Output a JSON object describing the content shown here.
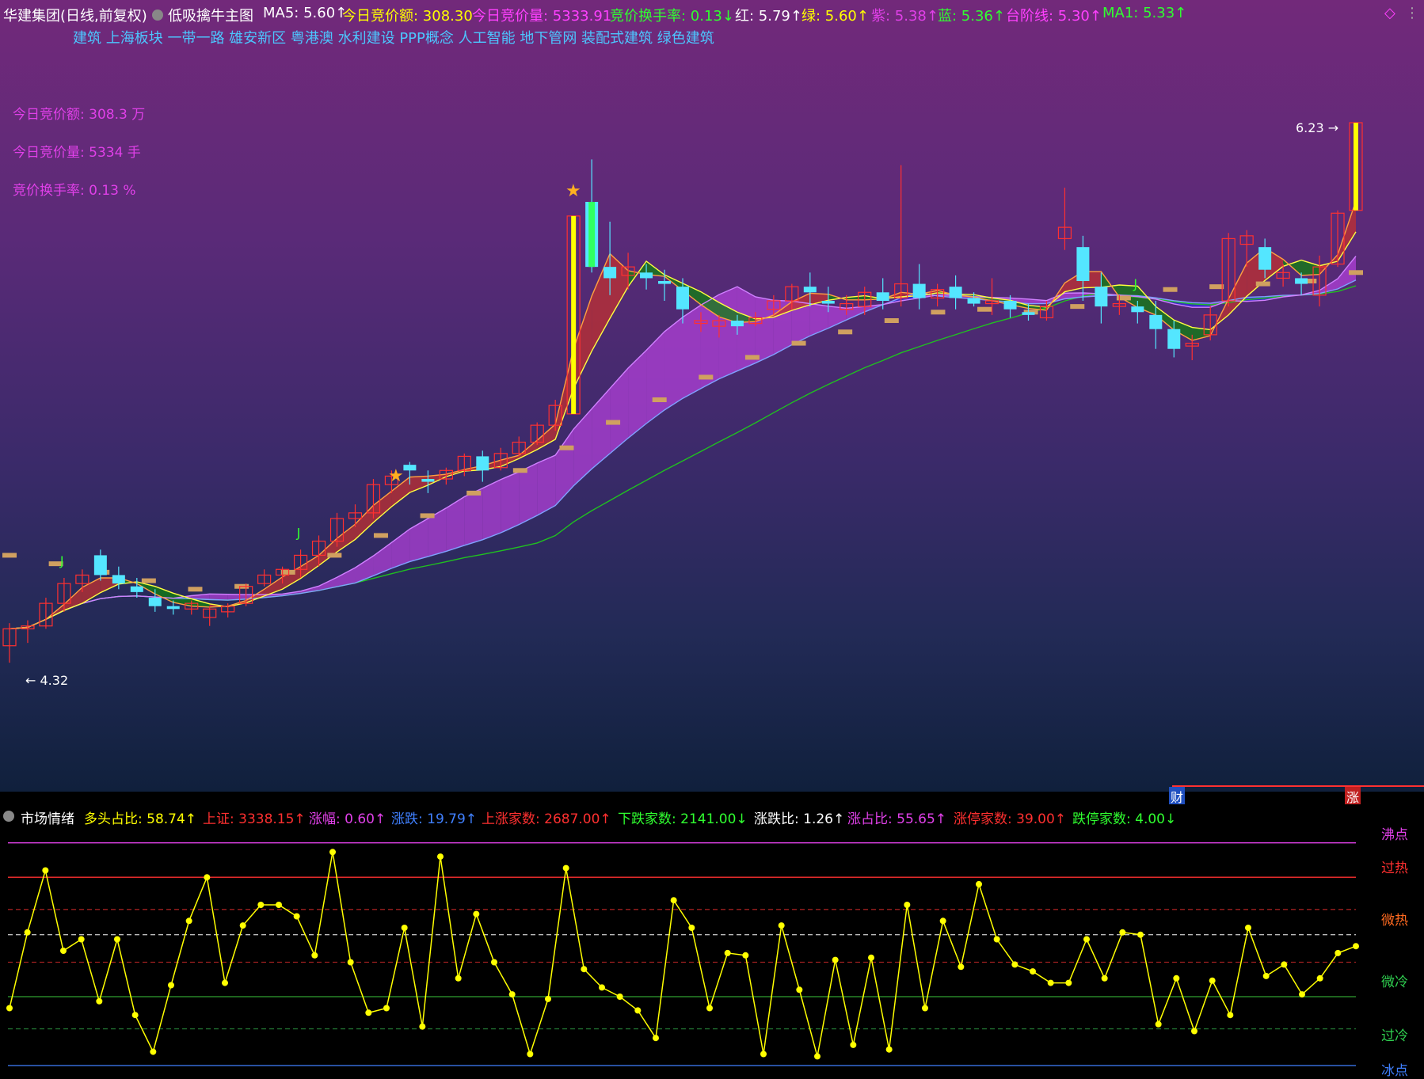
{
  "header": {
    "stock": "华建集团(日线,前复权)",
    "indicator": "低吸擒牛主图",
    "ma5": "MA5: 5.60↑",
    "bid_amount": "今日竞价额: 308.30",
    "bid_volume": "今日竞价量: 5333.91",
    "bid_turnover": "竞价换手率: 0.13↓",
    "red": "红: 5.79↑",
    "green": "绿: 5.60↑",
    "purple": "紫: 5.38↑",
    "blue": "蓝: 5.36↑",
    "step_line": "台阶线: 5.30↑",
    "ma1": "MA1: 5.33↑"
  },
  "concepts": "建筑 上海板块 一带一路 雄安新区 粤港澳 水利建设 PPP概念 人工智能 地下管网 装配式建筑 绿色建筑",
  "info_panel": {
    "amount": "今日竞价额: 308.3 万",
    "volume": "今日竞价量: 5334 手",
    "turnover": "竞价换手率: 0.13 %"
  },
  "price_labels": {
    "high": "6.23",
    "low": "4.32"
  },
  "markers": {
    "j": "J",
    "cai": "财",
    "zhang": "涨"
  },
  "sub_header": {
    "name": "市场情绪",
    "bull_ratio": "多头占比: 58.74↑",
    "shanghai": "上证: 3338.15↑",
    "change_pct": "涨幅: 0.60↑",
    "change": "涨跌: 19.79↑",
    "up_count": "上涨家数: 2687.00↑",
    "down_count": "下跌家数: 2141.00↓",
    "updown_ratio": "涨跌比: 1.26↑",
    "up_share": "涨占比: 55.65↑",
    "limit_up": "涨停家数: 39.00↑",
    "limit_down": "跌停家数: 4.00↓"
  },
  "zones": [
    "沸点",
    "过热",
    "微热",
    "微冷",
    "过冷",
    "冰点"
  ],
  "colors": {
    "up": "#ff3030",
    "down": "#54e6ff",
    "yellow": "#ffff00",
    "magenta": "#e040e8"
  },
  "chart_data": [
    {
      "type": "candlestick",
      "title": "低吸擒牛主图",
      "ylim": [
        4.2,
        6.3
      ],
      "candles": [
        [
          4.38,
          4.44,
          4.46,
          4.32
        ],
        [
          4.44,
          4.45,
          4.47,
          4.39
        ],
        [
          4.45,
          4.53,
          4.55,
          4.44
        ],
        [
          4.53,
          4.6,
          4.62,
          4.5
        ],
        [
          4.6,
          4.63,
          4.65,
          4.57
        ],
        [
          4.7,
          4.63,
          4.72,
          4.61
        ],
        [
          4.63,
          4.6,
          4.66,
          4.58
        ],
        [
          4.59,
          4.57,
          4.62,
          4.55
        ],
        [
          4.55,
          4.52,
          4.58,
          4.5
        ],
        [
          4.52,
          4.51,
          4.54,
          4.49
        ],
        [
          4.51,
          4.53,
          4.54,
          4.49
        ],
        [
          4.48,
          4.51,
          4.52,
          4.45
        ],
        [
          4.5,
          4.52,
          4.53,
          4.48
        ],
        [
          4.53,
          4.59,
          4.6,
          4.52
        ],
        [
          4.6,
          4.63,
          4.65,
          4.59
        ],
        [
          4.63,
          4.65,
          4.66,
          4.6
        ],
        [
          4.65,
          4.7,
          4.72,
          4.62
        ],
        [
          4.7,
          4.75,
          4.77,
          4.66
        ],
        [
          4.75,
          4.83,
          4.85,
          4.73
        ],
        [
          4.83,
          4.85,
          4.88,
          4.8
        ],
        [
          4.85,
          4.95,
          4.97,
          4.83
        ],
        [
          4.95,
          4.98,
          5.0,
          4.92
        ],
        [
          5.02,
          5.0,
          5.03,
          4.95
        ],
        [
          4.97,
          4.96,
          5.0,
          4.92
        ],
        [
          4.97,
          5.0,
          5.01,
          4.95
        ],
        [
          5.0,
          5.05,
          5.06,
          4.98
        ],
        [
          5.05,
          5.0,
          5.07,
          4.96
        ],
        [
          5.01,
          5.06,
          5.08,
          5.0
        ],
        [
          5.06,
          5.1,
          5.12,
          5.05
        ],
        [
          5.1,
          5.16,
          5.17,
          5.09
        ],
        [
          5.16,
          5.23,
          5.25,
          5.14
        ],
        [
          5.2,
          5.9,
          5.9,
          5.2
        ],
        [
          5.95,
          5.72,
          6.1,
          5.7
        ],
        [
          5.72,
          5.68,
          5.88,
          5.62
        ],
        [
          5.69,
          5.72,
          5.77,
          5.64
        ],
        [
          5.7,
          5.68,
          5.73,
          5.64
        ],
        [
          5.67,
          5.66,
          5.71,
          5.6
        ],
        [
          5.65,
          5.57,
          5.68,
          5.52
        ],
        [
          5.52,
          5.53,
          5.56,
          5.49
        ],
        [
          5.51,
          5.53,
          5.55,
          5.47
        ],
        [
          5.53,
          5.51,
          5.55,
          5.48
        ],
        [
          5.52,
          5.54,
          5.56,
          5.51
        ],
        [
          5.57,
          5.6,
          5.62,
          5.55
        ],
        [
          5.6,
          5.65,
          5.66,
          5.57
        ],
        [
          5.65,
          5.63,
          5.7,
          5.58
        ],
        [
          5.6,
          5.59,
          5.65,
          5.56
        ],
        [
          5.57,
          5.59,
          5.62,
          5.55
        ],
        [
          5.58,
          5.63,
          5.65,
          5.55
        ],
        [
          5.63,
          5.6,
          5.68,
          5.57
        ],
        [
          5.61,
          5.66,
          6.08,
          5.58
        ],
        [
          5.66,
          5.61,
          5.73,
          5.57
        ],
        [
          5.61,
          5.64,
          5.66,
          5.58
        ],
        [
          5.65,
          5.61,
          5.69,
          5.57
        ],
        [
          5.61,
          5.59,
          5.63,
          5.58
        ],
        [
          5.59,
          5.6,
          5.68,
          5.55
        ],
        [
          5.6,
          5.57,
          5.62,
          5.54
        ],
        [
          5.56,
          5.55,
          5.59,
          5.53
        ],
        [
          5.54,
          5.58,
          5.6,
          5.53
        ],
        [
          5.82,
          5.86,
          6.0,
          5.78
        ],
        [
          5.79,
          5.67,
          5.83,
          5.6
        ],
        [
          5.65,
          5.58,
          5.7,
          5.52
        ],
        [
          5.58,
          5.59,
          5.62,
          5.55
        ],
        [
          5.58,
          5.56,
          5.6,
          5.52
        ],
        [
          5.55,
          5.5,
          5.6,
          5.43
        ],
        [
          5.5,
          5.43,
          5.53,
          5.4
        ],
        [
          5.44,
          5.45,
          5.48,
          5.39
        ],
        [
          5.48,
          5.55,
          5.58,
          5.46
        ],
        [
          5.6,
          5.82,
          5.84,
          5.58
        ],
        [
          5.8,
          5.83,
          5.85,
          5.72
        ],
        [
          5.79,
          5.71,
          5.82,
          5.68
        ],
        [
          5.68,
          5.7,
          5.73,
          5.65
        ],
        [
          5.68,
          5.66,
          5.7,
          5.62
        ],
        [
          5.62,
          5.72,
          5.76,
          5.58
        ],
        [
          5.73,
          5.91,
          5.92,
          5.72
        ],
        [
          5.92,
          6.23,
          6.23,
          5.94
        ]
      ],
      "step_line": [
        4.7,
        4.67,
        4.64,
        4.61,
        4.58,
        4.59,
        4.64,
        4.7,
        4.77,
        4.84,
        4.92,
        5.0,
        5.08,
        5.17,
        5.25,
        5.33,
        5.4,
        5.45,
        5.49,
        5.53,
        5.56,
        5.57,
        5.56,
        5.58,
        5.61,
        5.64,
        5.65,
        5.66,
        5.67,
        5.7
      ],
      "j_marks": [
        3,
        16,
        62
      ]
    },
    {
      "type": "line",
      "title": "市场情绪",
      "ylim": [
        0,
        100
      ],
      "values": [
        25,
        58,
        85,
        50,
        55,
        28,
        55,
        22,
        6,
        35,
        63,
        82,
        36,
        61,
        70,
        70,
        65,
        48,
        93,
        45,
        23,
        25,
        60,
        17,
        91,
        38,
        66,
        45,
        31,
        5,
        29,
        86,
        42,
        34,
        30,
        24,
        12,
        72,
        60,
        25,
        49,
        48,
        5,
        61,
        33,
        4,
        46,
        9,
        47,
        7,
        70,
        25,
        63,
        43,
        79,
        55,
        44,
        41,
        36,
        36,
        55,
        38,
        58,
        57,
        18,
        38,
        15,
        37,
        22,
        60,
        39,
        44,
        31,
        38,
        49,
        52
      ]
    }
  ]
}
